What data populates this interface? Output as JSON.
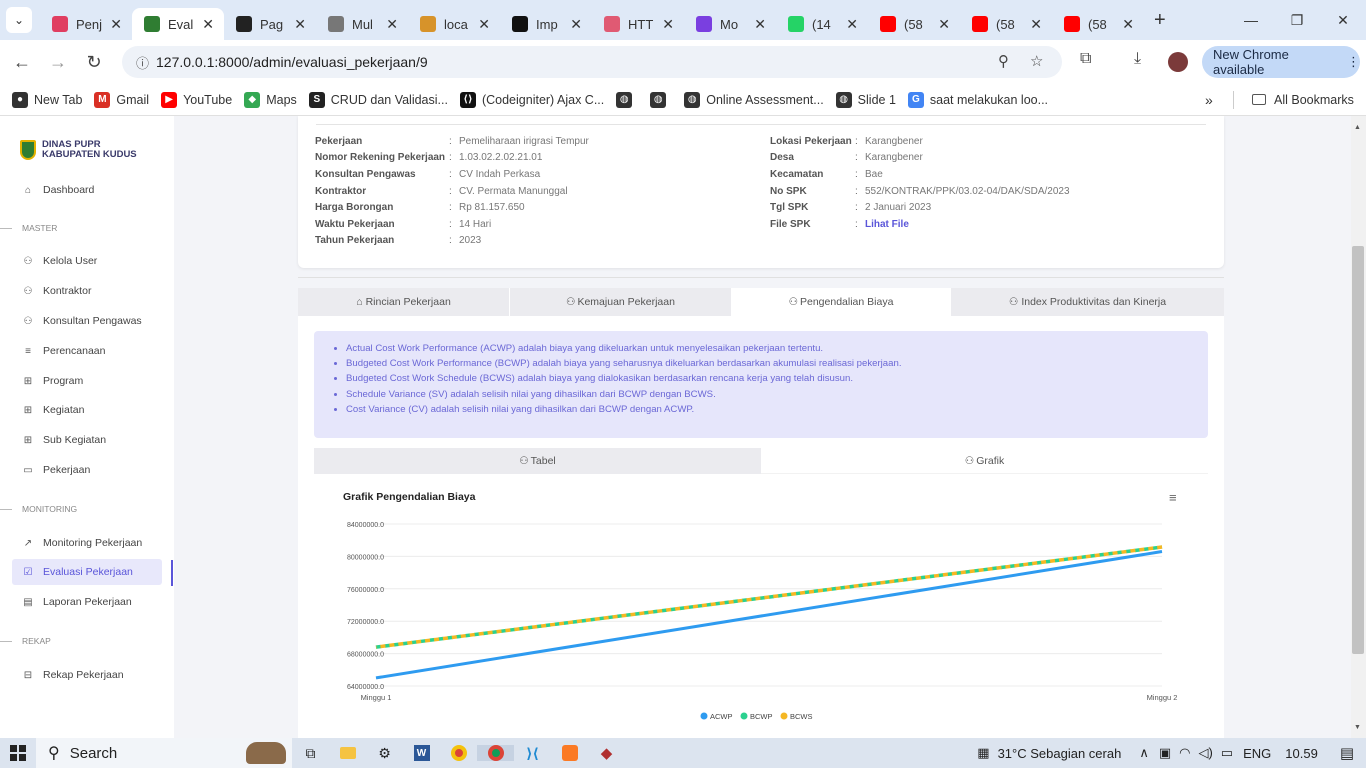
{
  "browser": {
    "tabs": [
      {
        "title": "Penj",
        "color": "#e03e61"
      },
      {
        "title": "Eval",
        "color": "#2f7d32",
        "active": true
      },
      {
        "title": "Pag",
        "color": "#222222"
      },
      {
        "title": "Mul",
        "color": "#777777"
      },
      {
        "title": "loca",
        "color": "#d7932a"
      },
      {
        "title": "Imp",
        "color": "#111111"
      },
      {
        "title": "HTT",
        "color": "#e05a73"
      },
      {
        "title": "Mo",
        "color": "#7a3fe0"
      },
      {
        "title": "(14",
        "color": "#25d366"
      },
      {
        "title": "(58",
        "color": "#ff0000"
      },
      {
        "title": "(58",
        "color": "#ff0000"
      },
      {
        "title": "(58",
        "color": "#ff0000"
      }
    ],
    "url": "127.0.0.1:8000/admin/evaluasi_pekerjaan/9",
    "update_label": "New Chrome available",
    "bookmarks": [
      {
        "label": "New Tab",
        "color": "#333333",
        "glyph": "●"
      },
      {
        "label": "Gmail",
        "color": "#d93025",
        "glyph": "M"
      },
      {
        "label": "YouTube",
        "color": "#ff0000",
        "glyph": "▶"
      },
      {
        "label": "Maps",
        "color": "#34a853",
        "glyph": "◆"
      },
      {
        "label": "CRUD dan Validasi...",
        "color": "#222222",
        "glyph": "S"
      },
      {
        "label": "(Codeigniter) Ajax C...",
        "color": "#111111",
        "glyph": "⟨⟩"
      },
      {
        "label": "",
        "color": "#333333",
        "glyph": "◍"
      },
      {
        "label": "",
        "color": "#333333",
        "glyph": "◍"
      },
      {
        "label": "Online Assessment...",
        "color": "#333333",
        "glyph": "◍"
      },
      {
        "label": "Slide 1",
        "color": "#333333",
        "glyph": "◍"
      },
      {
        "label": "saat melakukan loo...",
        "color": "#4285f4",
        "glyph": "G"
      }
    ],
    "all_bookmarks": "All Bookmarks"
  },
  "sidebar": {
    "brand_line1": "DINAS PUPR",
    "brand_line2": "KABUPATEN KUDUS",
    "dashboard": "Dashboard",
    "section_master": "MASTER",
    "section_monitoring": "MONITORING",
    "section_rekap": "REKAP",
    "items": {
      "kelola_user": "Kelola User",
      "kontraktor": "Kontraktor",
      "konsultan": "Konsultan Pengawas",
      "perencanaan": "Perencanaan",
      "program": "Program",
      "kegiatan": "Kegiatan",
      "sub_kegiatan": "Sub Kegiatan",
      "pekerjaan": "Pekerjaan",
      "monitoring": "Monitoring Pekerjaan",
      "evaluasi": "Evaluasi Pekerjaan",
      "laporan": "Laporan Pekerjaan",
      "rekap": "Rekap Pekerjaan"
    }
  },
  "info": {
    "left": [
      {
        "label": "Pekerjaan",
        "value": "Pemeliharaan irigrasi Tempur"
      },
      {
        "label": "Nomor Rekening Pekerjaan",
        "value": "1.03.02.2.02.21.01"
      },
      {
        "label": "Konsultan Pengawas",
        "value": "CV Indah Perkasa"
      },
      {
        "label": "Kontraktor",
        "value": "CV. Permata Manunggal"
      },
      {
        "label": "Harga Borongan",
        "value": "Rp 81.157.650"
      },
      {
        "label": "Waktu Pekerjaan",
        "value": "14 Hari"
      },
      {
        "label": "Tahun Pekerjaan",
        "value": "2023"
      }
    ],
    "right": [
      {
        "label": "Lokasi Pekerjaan",
        "value": "Karangbener"
      },
      {
        "label": "Desa",
        "value": "Karangbener"
      },
      {
        "label": "Kecamatan",
        "value": "Bae"
      },
      {
        "label": "No SPK",
        "value": "552/KONTRAK/PPK/03.02-04/DAK/SDA/2023"
      },
      {
        "label": "Tgl SPK",
        "value": "2 Januari 2023"
      },
      {
        "label": "File SPK",
        "value": "Lihat File"
      }
    ],
    "colon": ":"
  },
  "tabs": [
    "Rincian Pekerjaan",
    "Kemajuan Pekerjaan",
    "Pengendalian Biaya",
    "Index Produktivitas dan Kinerja"
  ],
  "notes": [
    "Actual Cost Work Performance (ACWP) adalah biaya yang dikeluarkan untuk menyelesaikan pekerjaan tertentu.",
    "Budgeted Cost Work Performance (BCWP) adalah biaya yang seharusnya dikeluarkan berdasarkan akumulasi realisasi pekerjaan.",
    "Budgeted Cost Work Schedule (BCWS) adalah biaya yang dialokasikan berdasarkan rencana kerja yang telah disusun.",
    "Schedule Variance (SV) adalah selisih nilai yang dihasilkan dari BCWP dengan BCWS.",
    "Cost Variance (CV) adalah selisih nilai yang dihasilkan dari BCWP dengan ACWP."
  ],
  "subtabs": [
    "Tabel",
    "Grafik"
  ],
  "chart_data": {
    "type": "line",
    "title": "Grafik Pengendalian Biaya",
    "categories": [
      "Minggu 1",
      "Minggu 2"
    ],
    "y_ticks": [
      "84000000.0",
      "80000000.0",
      "76000000.0",
      "72000000.0",
      "68000000.0",
      "64000000.0"
    ],
    "ylim": [
      64000000,
      84000000
    ],
    "series": [
      {
        "name": "ACWP",
        "values": [
          65000000,
          80600000
        ],
        "color": "#2e9bf0"
      },
      {
        "name": "BCWP",
        "values": [
          68800000,
          81157650
        ],
        "color": "#2bd18f"
      },
      {
        "name": "BCWS",
        "values": [
          68800000,
          81157650
        ],
        "color": "#f5b723"
      }
    ],
    "legend": "bottom",
    "grid": true
  },
  "taskbar": {
    "search": "Search",
    "weather": "31°C  Sebagian cerah",
    "lang": "ENG",
    "time": "10.59"
  }
}
